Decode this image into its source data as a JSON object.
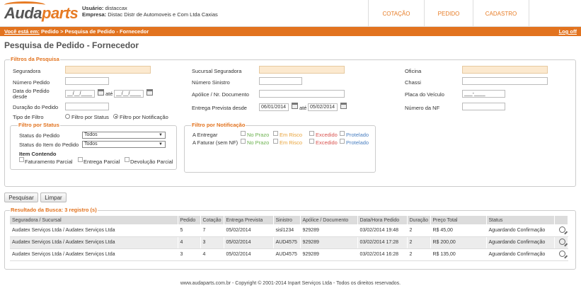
{
  "header": {
    "logo_main": "Auda",
    "logo_accent": "parts",
    "user_label": "Usuário:",
    "user_value": "distaccax",
    "company_label": "Empresa:",
    "company_value": "Distac Distr de Automoveis e Com Ltda Caxias",
    "nav": [
      "COTAÇÃO",
      "PEDIDO",
      "CADASTRO"
    ]
  },
  "breadcrumb": {
    "prefix": "Você está em:",
    "path": "Pedido > Pesquisa de Pedido - Fornecedor",
    "logoff": "Log off"
  },
  "page_title": "Pesquisa de Pedido - Fornecedor",
  "filters": {
    "legend": "Filtros da Pesquisa",
    "seguradora": "Seguradora",
    "numero_pedido": "Número Pedido",
    "data_pedido_1": "Data do Pedido",
    "data_pedido_2": "desde",
    "date_mask": "__/__/____",
    "ate": "até",
    "duracao_pedido": "Duração do Pedido",
    "tipo_filtro": "Tipo de Filtro",
    "radio_status": "Filtro por Status",
    "radio_notificacao": "Filtro por Notificação",
    "sucursal": "Sucursal Seguradora",
    "numero_sinistro": "Número Sinistro",
    "apolice": "Apólice / Nr. Documento",
    "entrega_prevista": "Entrega Prevista desde",
    "entrega_desde": "06/01/2014",
    "entrega_ate": "05/02/2014",
    "oficina": "Oficina",
    "chassi": "Chassi",
    "placa": "Placa do Veículo",
    "placa_mask": "___-____",
    "numero_nf": "Número da NF"
  },
  "status_filter": {
    "legend": "Filtro por Status",
    "status_pedido": "Status do Pedido",
    "status_item": "Status do Item do Pedido",
    "status_pedido_value": "Todos",
    "status_item_value": "Todos",
    "item_contendo": "Item Contendo",
    "options": [
      "Faturamento Parcial",
      "Entrega Parcial",
      "Devolução Parcial"
    ]
  },
  "notification_filter": {
    "legend": "Filtro por Notificação",
    "rows": [
      "A Entregar",
      "A Faturar (sem NF)"
    ],
    "options": [
      "No Prazo",
      "Em Risco",
      "Excedido",
      "Protelado"
    ],
    "option_colors": [
      "#6ab04c",
      "#e8a33a",
      "#d9534f",
      "#4a7fc1"
    ]
  },
  "buttons": {
    "search": "Pesquisar",
    "clear": "Limpar"
  },
  "results": {
    "legend": "Resultado da Busca: 3 registro (s)",
    "columns": [
      "Seguradora / Sucursal",
      "Pedido",
      "Cotação",
      "Entrega Prevista",
      "Sinistro",
      "Apólice / Documento",
      "Data/Hora Pedido",
      "Duração",
      "Preço Total",
      "Status"
    ],
    "rows": [
      [
        "Audatex Serviços Ltda / Audatex Serviços Ltda",
        "5",
        "7",
        "05/02/2014",
        "sisl1234",
        "929289",
        "03/02/2014 19:48",
        "2",
        "R$ 45,00",
        "Aguardando Confirmação"
      ],
      [
        "Audatex Serviços Ltda / Audatex Serviços Ltda",
        "4",
        "3",
        "05/02/2014",
        "AUD4575",
        "929289",
        "03/02/2014 17:28",
        "2",
        "R$ 200,00",
        "Aguardando Confirmação"
      ],
      [
        "Audatex Serviços Ltda / Audatex Serviços Ltda",
        "3",
        "4",
        "05/02/2014",
        "AUD4575",
        "929289",
        "03/02/2014 16:28",
        "2",
        "R$ 135,00",
        "Aguardando Confirmação"
      ]
    ]
  },
  "footer": "www.audaparts.com.br - Copyright © 2001-2014 Inpart Serviços Ltda - Todos os direitos reservados.",
  "colors": {
    "accent": "#e2731f",
    "peach": "#fce9cf"
  }
}
